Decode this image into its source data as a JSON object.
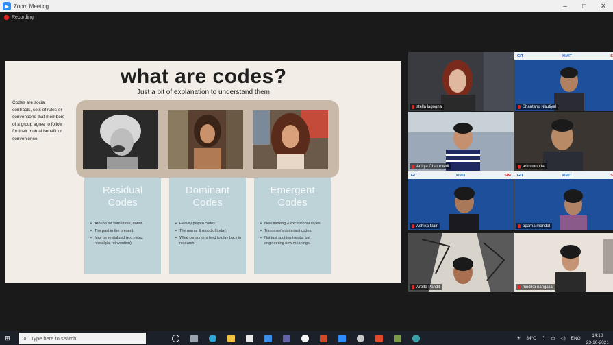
{
  "window": {
    "title": "Zoom Meeting",
    "minimize": "–",
    "maximize": "□",
    "close": "✕"
  },
  "recording": {
    "label": "Recording"
  },
  "slide": {
    "title": "what are codes?",
    "subtitle": "Just a bit of explanation to understand them",
    "description": "Codes are social contracts, sets of rules or conventions that members of a group agree to follow for their mutual benefit or convenience",
    "cards": [
      {
        "title_line1": "Residual",
        "title_line2": "Codes",
        "bullets": [
          "Around for some time, dated.",
          "The past in the present.",
          "May be revitalized (e.g. retro, nostalgia, reinvention)"
        ]
      },
      {
        "title_line1": "Dominant",
        "title_line2": "Codes",
        "bullets": [
          "Heavily played codes.",
          "The norms & mood of today.",
          "What consumers tend to play back in research."
        ]
      },
      {
        "title_line1": "Emergent",
        "title_line2": "Codes",
        "bullets": [
          "New thinking & exceptional styles.",
          "Tomorrow's dominant codes.",
          "Not just spotting trends, but engineering new meanings."
        ]
      }
    ]
  },
  "banner": {
    "left": "GIT",
    "center": "XIMIT",
    "right": "SIM"
  },
  "participants": [
    {
      "name": "stella lagogna"
    },
    {
      "name": "Shantanu Nautiyal"
    },
    {
      "name": "Aditya Chaturvedi"
    },
    {
      "name": "arko mondal"
    },
    {
      "name": "Ashika Nair"
    },
    {
      "name": "aparna mandal"
    },
    {
      "name": "Arpita Pandit"
    },
    {
      "name": "mridika nangalia"
    }
  ],
  "taskbar": {
    "search_placeholder": "Type here to search",
    "weather": "34°C",
    "language": "ENG",
    "time": "14:18",
    "date": "23-10-2021"
  },
  "colors": {
    "slide_bg": "#f2ede6",
    "card_bg": "#bdd3d8",
    "band_bg": "#c9b9a8",
    "active_border": "#d6e05a"
  }
}
